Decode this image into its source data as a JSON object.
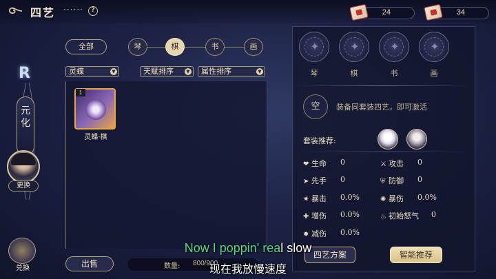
{
  "header": {
    "title": "四艺",
    "title_dots": "······",
    "help_icon": "?",
    "currencies": [
      {
        "icon": "red-scroll-ticket-icon",
        "value": "24"
      },
      {
        "icon": "red-scroll-ticket-icon",
        "value": "34"
      }
    ]
  },
  "left_nav": {
    "emblem": "R",
    "character_name": "元化",
    "change_label": "更换",
    "exchange_label": "兑换"
  },
  "categories": {
    "all_label": "全部",
    "items": [
      "琴",
      "棋",
      "书",
      "画"
    ],
    "active_index": 1
  },
  "filters": {
    "type": "灵蝶",
    "talent_sort": "天赋排序",
    "attr_sort": "属性排序"
  },
  "inventory": {
    "items": [
      {
        "name": "灵蝶·棋",
        "quantity": "1"
      }
    ],
    "sell_label": "出售",
    "quantity_label": "数量:",
    "quantity_value": "800/900"
  },
  "set_panel": {
    "slots": [
      "琴",
      "棋",
      "书",
      "画"
    ],
    "empty_label": "空",
    "empty_tip": "装备同套装四艺，即可激活",
    "recommend_label": "套装推荐:",
    "stats": [
      {
        "icon": "heart-icon",
        "label": "生命",
        "value": "0"
      },
      {
        "icon": "sword-icon",
        "label": "攻击",
        "value": "0"
      },
      {
        "icon": "arrow-icon",
        "label": "先手",
        "value": "0"
      },
      {
        "icon": "shield-icon",
        "label": "防御",
        "value": "0"
      },
      {
        "icon": "claw-icon",
        "label": "暴击",
        "value": "0.0%"
      },
      {
        "icon": "burst-icon",
        "label": "暴伤",
        "value": "0.0%"
      },
      {
        "icon": "plus-icon",
        "label": "增伤",
        "value": "0.0%"
      },
      {
        "icon": "flame-icon",
        "label": "初始怒气",
        "value": "0"
      },
      {
        "icon": "minus-icon",
        "label": "减伤",
        "value": "0.0%"
      }
    ],
    "plan_label": "四艺方案",
    "smart_label": "智能推荐"
  },
  "subtitles": {
    "en_highlight": "Now I poppin' rea",
    "en_rest": "l slow",
    "zh": "现在我放慢速度"
  }
}
